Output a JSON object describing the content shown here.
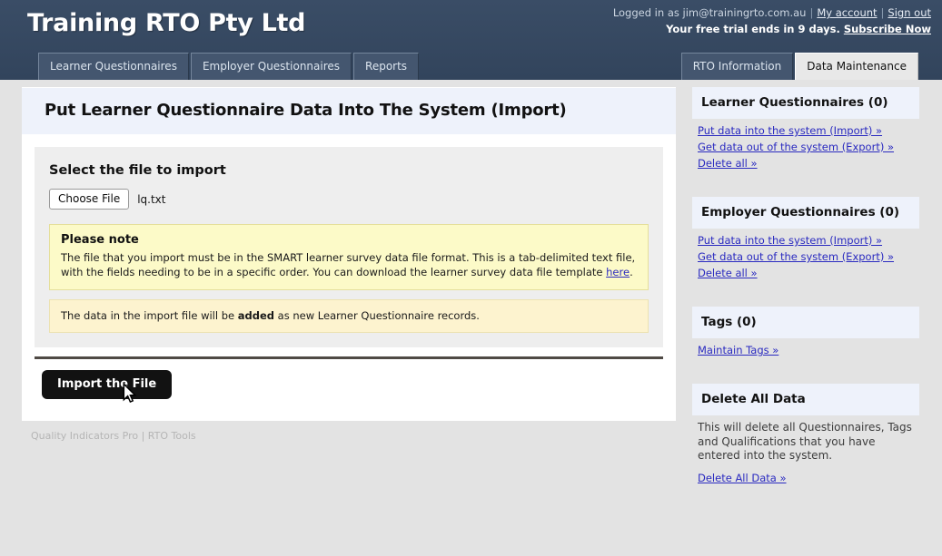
{
  "header": {
    "brand": "Training RTO Pty Ltd",
    "logged_in_prefix": "Logged in as ",
    "user_email": "jim@trainingrto.com.au",
    "my_account": "My account",
    "sign_out": "Sign out",
    "trial_text": "Your free trial ends in 9 days.",
    "subscribe": "Subscribe Now",
    "separator": "|"
  },
  "tabs_left": [
    {
      "label": "Learner Questionnaires",
      "active": false
    },
    {
      "label": "Employer Questionnaires",
      "active": false
    },
    {
      "label": "Reports",
      "active": false
    }
  ],
  "tabs_right": [
    {
      "label": "RTO Information",
      "active": false
    },
    {
      "label": "Data Maintenance",
      "active": true
    }
  ],
  "main": {
    "page_title": "Put Learner Questionnaire Data Into The System (Import)",
    "select_file_heading": "Select the file to import",
    "choose_file_label": "Choose File",
    "selected_file_name": "lq.txt",
    "note_title": "Please note",
    "note_body_part1": "The file that you import must be in the SMART learner survey data file format. This is a tab-delimited text file, with the fields needing to be in a specific order. You can download the learner survey data file template ",
    "note_link": "here",
    "note_body_part2": ".",
    "added_part1": "The data in the import file will be ",
    "added_bold": "added",
    "added_part2": " as new Learner Questionnaire records.",
    "import_button": "Import the File"
  },
  "sidebar": {
    "cards": [
      {
        "title": "Learner Questionnaires (0)",
        "links": [
          "Put data into the system (Import) »",
          "Get data out of the system (Export) »",
          "Delete all »"
        ],
        "text": ""
      },
      {
        "title": "Employer Questionnaires (0)",
        "links": [
          "Put data into the system (Import) »",
          "Get data out of the system (Export) »",
          "Delete all »"
        ],
        "text": ""
      },
      {
        "title": "Tags (0)",
        "links": [
          "Maintain Tags »"
        ],
        "text": ""
      },
      {
        "title": "Delete All Data",
        "links": [
          "Delete All Data »"
        ],
        "text": "This will delete all Questionnaires, Tags and Qualifications that you have entered into the system."
      }
    ]
  },
  "footer": {
    "text": "Quality Indicators Pro | RTO Tools"
  },
  "colors": {
    "header_bg": "#34465e",
    "tab_active_bg": "#e8e8e8",
    "title_bar_bg": "#eef2fb",
    "note_bg": "#fcfac8",
    "added_bg": "#fdf3cf",
    "link": "#2a2ac0",
    "button_bg": "#121212",
    "page_bg": "#e3e3e3"
  }
}
